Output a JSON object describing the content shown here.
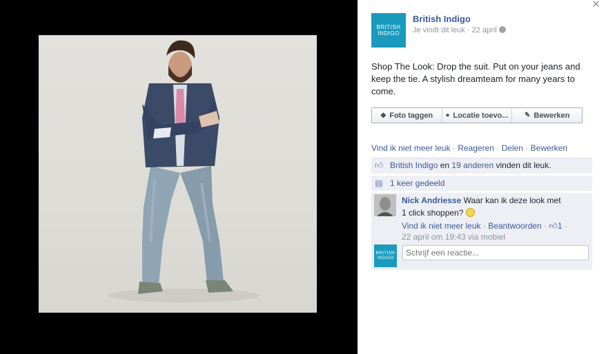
{
  "photo": {
    "alt": ""
  },
  "post": {
    "page_name": "British Indigo",
    "page_logo": {
      "line1": "BRITISH",
      "line2": "INDIGO"
    },
    "meta": "Je vindt dit leuk · 22 april",
    "text": "Shop The Look: Drop the suit. Put on your jeans and keep the tie. A stylish dreamteam for many years to come."
  },
  "actions": {
    "tag": "Foto taggen",
    "location": "Locatie toevo...",
    "edit": "Bewerken"
  },
  "links": {
    "unlike": "Vind ik niet meer leuk",
    "comment": "Reageren",
    "share": "Delen",
    "edit": "Bewerken",
    "separator": "·"
  },
  "likes": {
    "page": "British Indigo",
    "and": "en",
    "others": "19 anderen",
    "suffix": "vinden dit leuk."
  },
  "shares": {
    "text": "1 keer gedeeld"
  },
  "comment": {
    "author": "Nick Andriesse",
    "text": "Waar kan ik deze look met 1 click shoppen?",
    "unlike": "Vind ik niet meer leuk",
    "reply": "Beantwoorden",
    "like_count": "1",
    "time": "22 april om 19:43 via mobiel"
  },
  "reply": {
    "placeholder": "Schrijf een reactie...",
    "logo": {
      "line1": "BRITISH",
      "line2": "INDIGO"
    }
  },
  "colors": {
    "brand": "#1a9bbd",
    "link": "#3b5998",
    "ufi_bg": "#edeff4"
  },
  "icons": {
    "close": "close-icon",
    "tag": "tag-icon",
    "location": "map-pin-icon",
    "edit": "pencil-icon",
    "like": "thumbs-up-icon",
    "share": "share-icon",
    "globe": "globe-icon",
    "smiley": "smiley-icon"
  }
}
